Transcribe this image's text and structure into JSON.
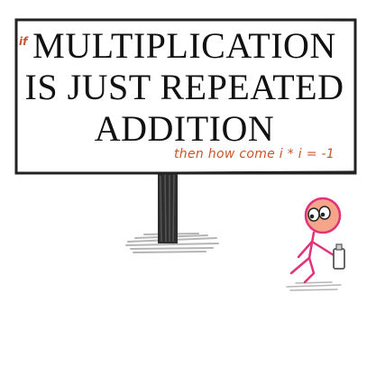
{
  "sign": {
    "prefix": "if",
    "line1": "MULTIPLICATION",
    "line2": "IS JUST REPEATED",
    "line3": "ADDITION",
    "subline": "then how come i * i = -1"
  },
  "colors": {
    "ink": "#111111",
    "handwriting": "#c8552a",
    "stick_figure": "#e0337a",
    "post": "#2e2e2e",
    "grass": "#b5b5b5"
  }
}
